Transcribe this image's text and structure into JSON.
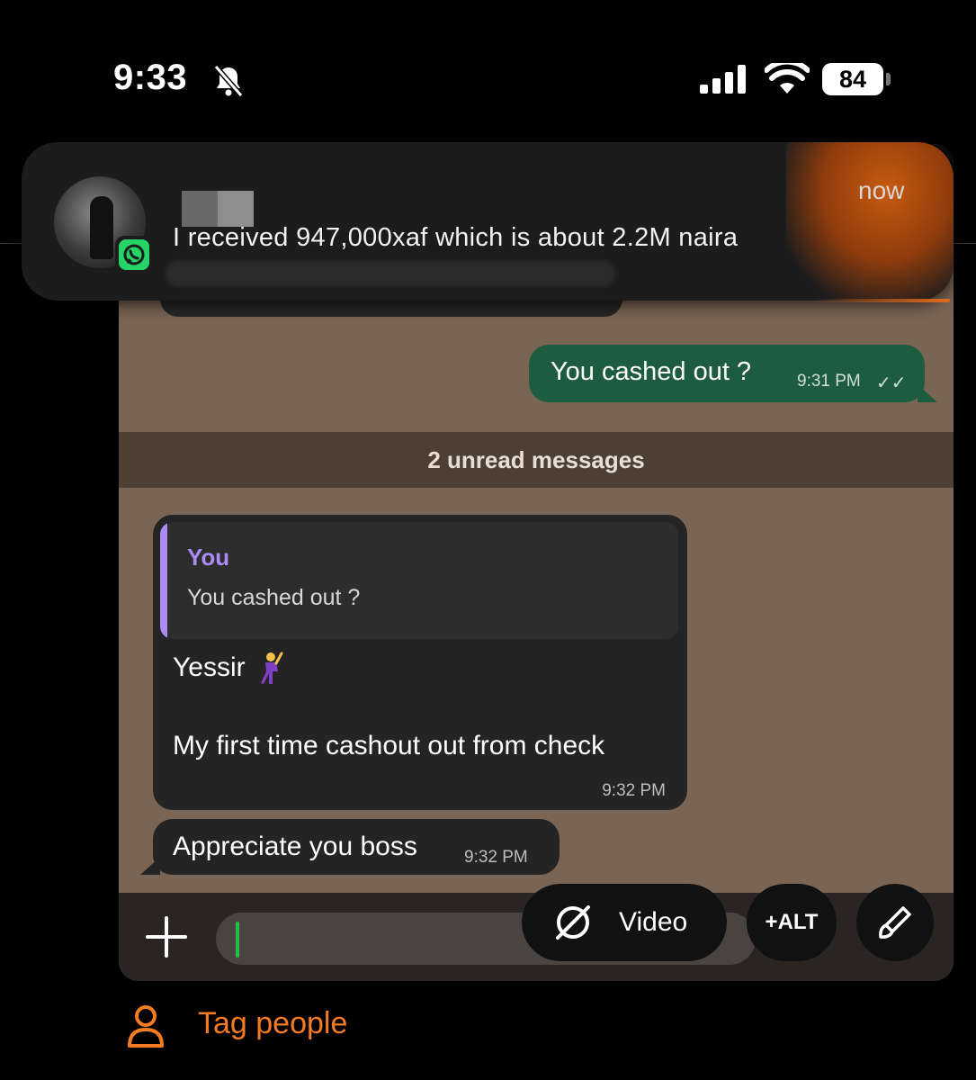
{
  "status_bar": {
    "time": "9:33",
    "battery": "84",
    "icons": [
      "bell-slash-icon",
      "signal-icon",
      "wifi-icon",
      "battery-icon"
    ]
  },
  "notification": {
    "message": "I received 947,000xaf which is about 2.2M naira",
    "time": "now",
    "app_icon": "whatsapp-icon"
  },
  "chat": {
    "outgoing": {
      "text": "You cashed out ?",
      "time": "9:31 PM",
      "ticks": "✓✓"
    },
    "unread_label": "2 unread messages",
    "incoming_reply": {
      "quote_author": "You",
      "quote_text": "You cashed out ?",
      "line1": "Yessir",
      "line2": "My first time cashout out from check",
      "time": "9:32 PM"
    },
    "incoming": {
      "text": "Appreciate you boss",
      "time": "9:32 PM"
    }
  },
  "toolbar": {
    "video_label": "Video",
    "alt_label": "+ALT"
  },
  "tag": {
    "label": "Tag people"
  },
  "colors": {
    "accent": "#f47b20",
    "bubble_out": "#1e5c3f",
    "bubble_in": "#242424",
    "quote_accent": "#a98bf3"
  }
}
